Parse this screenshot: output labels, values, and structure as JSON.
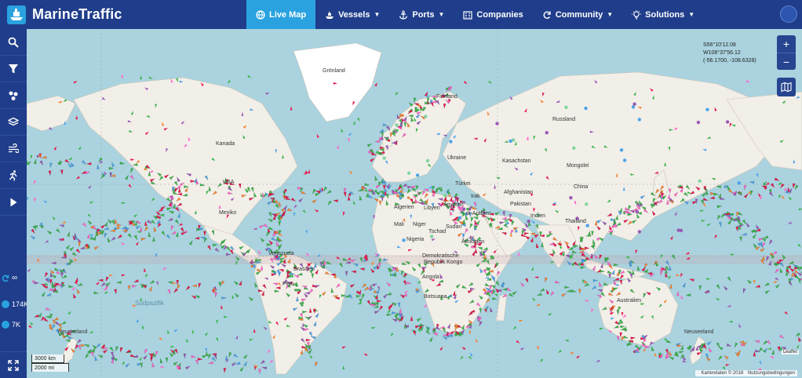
{
  "brand": {
    "name": "MarineTraffic"
  },
  "nav": [
    {
      "label": "Live Map",
      "icon": "globe-icon",
      "active": true,
      "caret": false
    },
    {
      "label": "Vessels",
      "icon": "ship-icon",
      "active": false,
      "caret": true
    },
    {
      "label": "Ports",
      "icon": "anchor-icon",
      "active": false,
      "caret": true
    },
    {
      "label": "Companies",
      "icon": "building-icon",
      "active": false,
      "caret": false
    },
    {
      "label": "Community",
      "icon": "refresh-icon",
      "active": false,
      "caret": true
    },
    {
      "label": "Solutions",
      "icon": "lightbulb-icon",
      "active": false,
      "caret": true
    }
  ],
  "sidebar": {
    "stats": [
      {
        "value": "∞",
        "icon": "loop-icon"
      },
      {
        "value": "174K",
        "icon": "info-icon"
      },
      {
        "value": "7K",
        "icon": "target-icon"
      }
    ]
  },
  "map": {
    "coords": {
      "line1": "S56°10'12.08",
      "line2": "W108°37'56.12",
      "line3": "(-56.1700, -108.6328)"
    },
    "zoom_in": "+",
    "zoom_out": "−",
    "scale_km": "3000 km",
    "scale_mi": "2000 mi",
    "attribution": "Kartendaten © 2018",
    "terms": "Nutzungsbedingungen",
    "leaflet": "Leaflet",
    "labels": {
      "gronland": "Grönland",
      "finnland": "Finnland",
      "russland": "Russland",
      "kanada": "Kanada",
      "usa": "USA",
      "mexiko": "Mexiko",
      "kasachstan": "Kasachstan",
      "mongolei": "Mongolei",
      "china": "China",
      "ukraine": "Ukraine",
      "turkei": "Türkei",
      "irak": "Irak",
      "afghanistan": "Afghanistan",
      "pakistan": "Pakistan",
      "indien": "Indien",
      "thailand": "Thailand",
      "algerien": "Algerien",
      "libyen": "Libyen",
      "agypten": "Ägypten",
      "saudi": "di-Arabien",
      "mali": "Mali",
      "niger": "Niger",
      "tschad": "Tschad",
      "sudan": "Sudan",
      "nigeria": "Nigeria",
      "athiopien": "Äthiopien",
      "kongo1": "Demokratische",
      "kongo2": "Republik Kongo",
      "angola": "Angola",
      "botsuana": "Botsuana",
      "venezuela": "Venezuela",
      "brasilien": "Brasilien",
      "peru": "Peru",
      "australien": "Australien",
      "neuseeland_w": "Neuseeland",
      "neuseeland_e": "Neuseeland",
      "sudpazifik": "Südpazifik"
    }
  }
}
